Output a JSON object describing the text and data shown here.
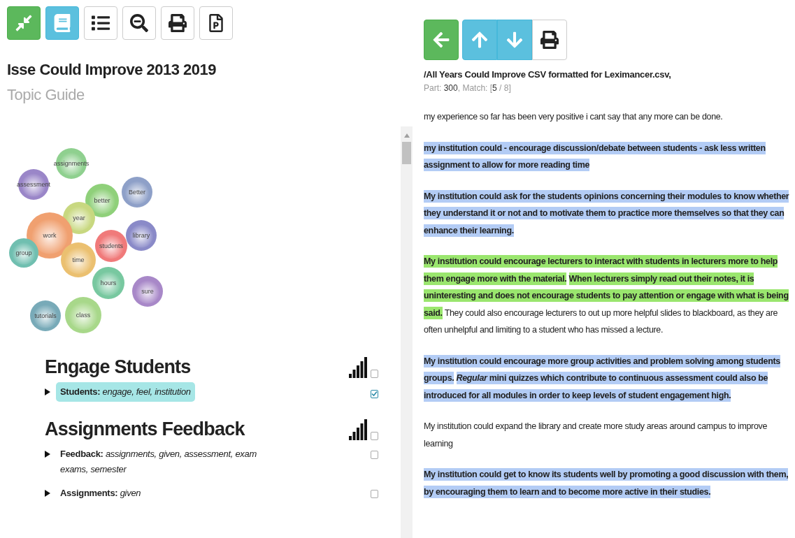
{
  "title": "Isse Could Improve 2013 2019",
  "subtitle": "Topic Guide",
  "bubbles": [
    {
      "label": "assessment",
      "color": "#9a86c8"
    },
    {
      "label": "assignments",
      "color": "#8fd08f"
    },
    {
      "label": "better",
      "color": "#8fd07a"
    },
    {
      "label": "Better",
      "color": "#8ea0c8"
    },
    {
      "label": "year",
      "color": "#c8d880"
    },
    {
      "label": "work",
      "color": "#f0a070"
    },
    {
      "label": "library",
      "color": "#8a8ac8"
    },
    {
      "label": "group",
      "color": "#70bfb0"
    },
    {
      "label": "students",
      "color": "#f07a7a"
    },
    {
      "label": "time",
      "color": "#ebc070"
    },
    {
      "label": "hours",
      "color": "#78c8a0"
    },
    {
      "label": "sure",
      "color": "#a888c8"
    },
    {
      "label": "tutorials",
      "color": "#78aab8"
    },
    {
      "label": "class",
      "color": "#a8d88a"
    }
  ],
  "themes": [
    {
      "title": "Engage Students",
      "checked": false,
      "concepts": [
        {
          "name": "Students:",
          "terms": "engage, feel, institution",
          "selected": true,
          "checked": true
        }
      ]
    },
    {
      "title": "Assignments Feedback",
      "checked": false,
      "concepts": [
        {
          "name": "Feedback:",
          "terms": "assignments, given, assessment, exam exams, semester",
          "selected": false,
          "checked": false
        },
        {
          "name": "Assignments:",
          "terms": "given",
          "selected": false,
          "checked": false
        }
      ]
    }
  ],
  "file_path": "/All Years Could Improve CSV formatted for Leximancer.csv,",
  "match_info": "Part: **300**, Match: [**5** / 8]",
  "passages": [
    {
      "segments": [
        {
          "text": "my experience so far has been very positive i cant say that any more can be done.",
          "highlighted": false
        }
      ]
    },
    {
      "segments": [
        {
          "text": "my institution could - encourage discussion/debate between students - ask less written assignment to allow for more reading time",
          "highlighted": true,
          "color": "#b3ccf5"
        }
      ]
    },
    {
      "segments": [
        {
          "text": "My institution could ask for the students opinions concerning their modules to know whether they understand it or not and to motivate them to practice more themselves so that they can enhance their learning.",
          "highlighted": true,
          "color": "#b3ccf5"
        }
      ]
    },
    {
      "segments": [
        {
          "text": "My institution could encourage lecturers to interact with students in lecturers more to help them engage more with the material.",
          "highlighted": true,
          "color": "#9ae66e"
        },
        {
          "text": "When lecturers simply read out their notes, it is uninteresting and does not encourage students to pay attention or engage with what is being said.",
          "highlighted": true,
          "color": "#9ae66e"
        },
        {
          "text": "They could also encourage lecturers to out up more helpful slides to blackboard, as they are often unhelpful and limiting to a student who has missed a lecture.",
          "highlighted": false
        }
      ]
    },
    {
      "segments": [
        {
          "text": "My institution could encourage more group activities and problem solving among students groups.",
          "highlighted": true,
          "color": "#b3ccf5"
        },
        {
          "text": "*Regular* mini quizzes which contribute to continuous assessment could also be introduced for all modules in order to keep levels of student engagement high.",
          "highlighted": true,
          "color": "#b3ccf5"
        }
      ]
    },
    {
      "segments": [
        {
          "text": "My institution could expand the library and create more study areas around campus to improve learning",
          "highlighted": false
        }
      ]
    },
    {
      "segments": [
        {
          "text": "My institution could get to know its students well by promoting a good discussion with them, by encouraging them to learn and to become more active in their studies.",
          "highlighted": true,
          "color": "#b3ccf5"
        }
      ]
    }
  ]
}
